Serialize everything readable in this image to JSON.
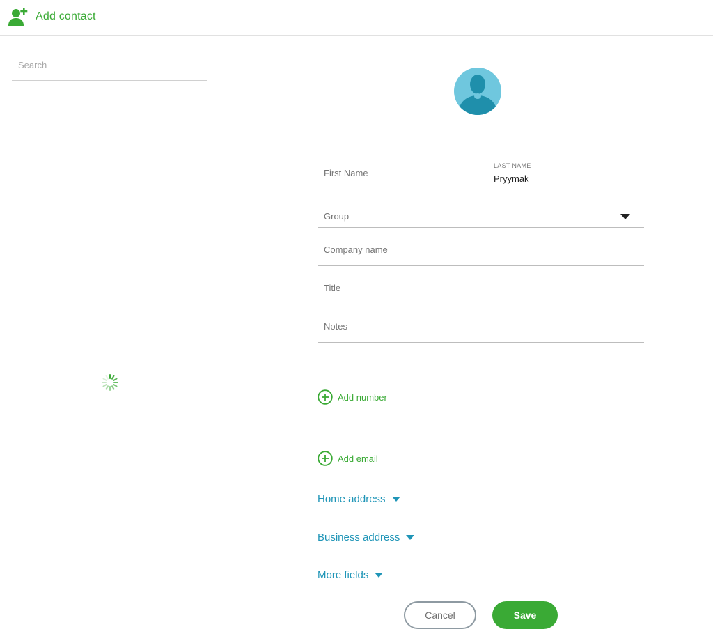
{
  "header": {
    "add_contact_label": "Add contact"
  },
  "sidebar": {
    "search_placeholder": "Search"
  },
  "form": {
    "first_name": {
      "placeholder": "First Name",
      "value": ""
    },
    "last_name": {
      "label": "LAST NAME",
      "value": "Pryymak"
    },
    "group": {
      "placeholder": "Group"
    },
    "company_name": {
      "placeholder": "Company name"
    },
    "title": {
      "placeholder": "Title"
    },
    "notes": {
      "placeholder": "Notes"
    },
    "add_number_label": "Add number",
    "add_email_label": "Add email",
    "home_address_label": "Home address",
    "business_address_label": "Business address",
    "more_fields_label": "More fields"
  },
  "actions": {
    "cancel_label": "Cancel",
    "save_label": "Save"
  },
  "colors": {
    "accent_green": "#3aaa35",
    "link_blue": "#1f95b7",
    "avatar_blue": "#6fc7de"
  }
}
